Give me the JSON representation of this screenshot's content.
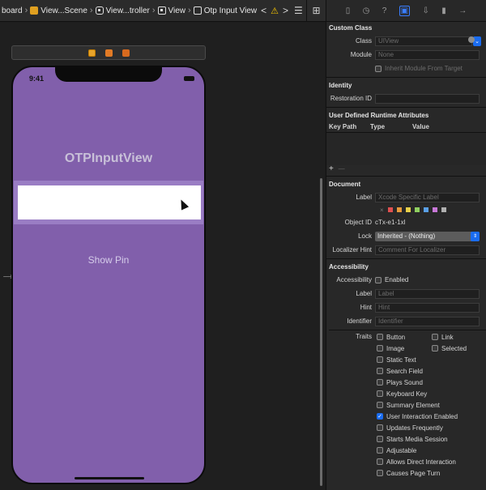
{
  "jumpbar": {
    "crumbs": [
      "board",
      "View...Scene",
      "View...troller",
      "View",
      "Otp Input View"
    ],
    "nav_back": "<",
    "nav_fwd": ">",
    "warning": "⚠",
    "lines_icon": "☰",
    "split_icon": "⊞"
  },
  "canvas": {
    "status_time": "9:41",
    "title": "OTPInputView",
    "show_pin": "Show Pin"
  },
  "inspector": {
    "custom_class": {
      "title": "Custom Class",
      "class_label": "Class",
      "class_placeholder": "UIView",
      "module_label": "Module",
      "module_placeholder": "None",
      "inherit_label": "Inherit Module From Target"
    },
    "identity": {
      "title": "Identity",
      "restoration_label": "Restoration ID"
    },
    "udra": {
      "title": "User Defined Runtime Attributes",
      "col_key": "Key Path",
      "col_type": "Type",
      "col_value": "Value",
      "add": "+",
      "remove": "—"
    },
    "document": {
      "title": "Document",
      "label_label": "Label",
      "label_placeholder": "Xcode Specific Label",
      "swatch_colors": [
        "#e05050",
        "#e89a3c",
        "#e8d04a",
        "#8fd060",
        "#5aa0e8",
        "#c878d8",
        "#b0b0b0"
      ],
      "object_id_label": "Object ID",
      "object_id": "cTx-e1-1xl",
      "lock_label": "Lock",
      "lock_value": "Inherited - (Nothing)",
      "hint_label": "Localizer Hint",
      "hint_placeholder": "Comment For Localizer"
    },
    "accessibility": {
      "title": "Accessibility",
      "acc_label": "Accessibility",
      "enabled_label": "Enabled",
      "label_label": "Label",
      "label_placeholder": "Label",
      "hint_label": "Hint",
      "hint_placeholder": "Hint",
      "identifier_label": "Identifier",
      "identifier_placeholder": "Identifier",
      "traits_label": "Traits",
      "traits": [
        {
          "label": "Button",
          "checked": false
        },
        {
          "label": "Link",
          "checked": false
        },
        {
          "label": "Image",
          "checked": false
        },
        {
          "label": "Selected",
          "checked": false
        }
      ],
      "traits_single": [
        {
          "label": "Static Text",
          "checked": false
        },
        {
          "label": "Search Field",
          "checked": false
        },
        {
          "label": "Plays Sound",
          "checked": false
        },
        {
          "label": "Keyboard Key",
          "checked": false
        },
        {
          "label": "Summary Element",
          "checked": false
        },
        {
          "label": "User Interaction Enabled",
          "checked": true
        },
        {
          "label": "Updates Frequently",
          "checked": false
        },
        {
          "label": "Starts Media Session",
          "checked": false
        },
        {
          "label": "Adjustable",
          "checked": false
        },
        {
          "label": "Allows Direct Interaction",
          "checked": false
        },
        {
          "label": "Causes Page Turn",
          "checked": false
        }
      ]
    }
  }
}
